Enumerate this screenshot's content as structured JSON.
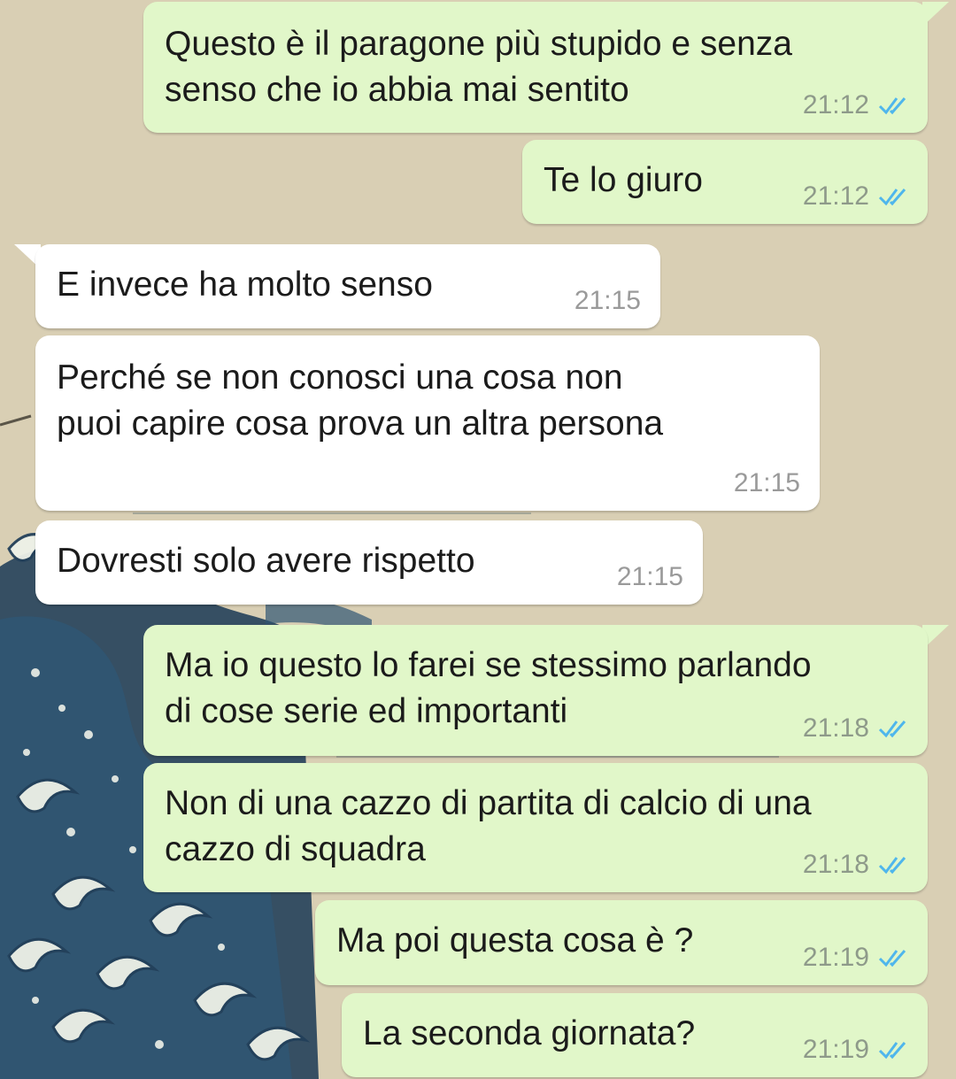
{
  "colors": {
    "outgoing_bubble": "#e1f7c9",
    "incoming_bubble": "#ffffff",
    "read_ticks": "#4fb6ec",
    "wallpaper": "#d9cfb4"
  },
  "icons": {
    "read_receipt": "double-check-icon"
  },
  "messages": [
    {
      "direction": "out",
      "text": "Questo è il paragone più stupido e senza\nsenso che io abbia mai sentito",
      "time": "21:12",
      "status": "read"
    },
    {
      "direction": "out",
      "text": "Te lo giuro",
      "time": "21:12",
      "status": "read"
    },
    {
      "direction": "in",
      "text": "E invece ha molto senso",
      "time": "21:15"
    },
    {
      "direction": "in",
      "text": "Perché se non conosci una cosa non\npuoi capire cosa prova un altra persona",
      "time": "21:15"
    },
    {
      "direction": "in",
      "text": "Dovresti solo avere rispetto",
      "time": "21:15"
    },
    {
      "direction": "out",
      "text": "Ma io questo lo farei se stessimo parlando\ndi cose serie ed importanti",
      "time": "21:18",
      "status": "read"
    },
    {
      "direction": "out",
      "text": "Non di una cazzo di partita di calcio di una\ncazzo di squadra",
      "time": "21:18",
      "status": "read"
    },
    {
      "direction": "out",
      "text": "Ma poi questa cosa è ?",
      "time": "21:19",
      "status": "read"
    },
    {
      "direction": "out",
      "text": "La seconda giornata?",
      "time": "21:19",
      "status": "read"
    }
  ]
}
